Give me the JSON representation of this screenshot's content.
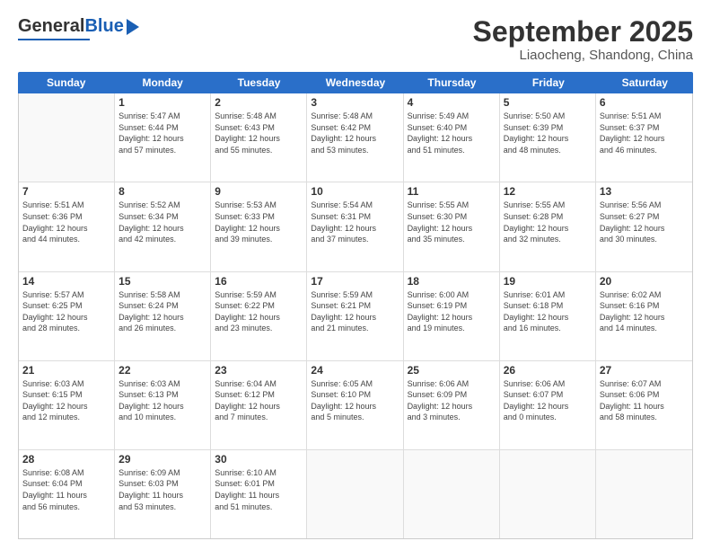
{
  "logo": {
    "general": "General",
    "blue": "Blue"
  },
  "title": {
    "main": "September 2025",
    "sub": "Liaocheng, Shandong, China"
  },
  "calendar": {
    "headers": [
      "Sunday",
      "Monday",
      "Tuesday",
      "Wednesday",
      "Thursday",
      "Friday",
      "Saturday"
    ],
    "rows": [
      [
        {
          "day": "",
          "info": ""
        },
        {
          "day": "1",
          "info": "Sunrise: 5:47 AM\nSunset: 6:44 PM\nDaylight: 12 hours\nand 57 minutes."
        },
        {
          "day": "2",
          "info": "Sunrise: 5:48 AM\nSunset: 6:43 PM\nDaylight: 12 hours\nand 55 minutes."
        },
        {
          "day": "3",
          "info": "Sunrise: 5:48 AM\nSunset: 6:42 PM\nDaylight: 12 hours\nand 53 minutes."
        },
        {
          "day": "4",
          "info": "Sunrise: 5:49 AM\nSunset: 6:40 PM\nDaylight: 12 hours\nand 51 minutes."
        },
        {
          "day": "5",
          "info": "Sunrise: 5:50 AM\nSunset: 6:39 PM\nDaylight: 12 hours\nand 48 minutes."
        },
        {
          "day": "6",
          "info": "Sunrise: 5:51 AM\nSunset: 6:37 PM\nDaylight: 12 hours\nand 46 minutes."
        }
      ],
      [
        {
          "day": "7",
          "info": "Sunrise: 5:51 AM\nSunset: 6:36 PM\nDaylight: 12 hours\nand 44 minutes."
        },
        {
          "day": "8",
          "info": "Sunrise: 5:52 AM\nSunset: 6:34 PM\nDaylight: 12 hours\nand 42 minutes."
        },
        {
          "day": "9",
          "info": "Sunrise: 5:53 AM\nSunset: 6:33 PM\nDaylight: 12 hours\nand 39 minutes."
        },
        {
          "day": "10",
          "info": "Sunrise: 5:54 AM\nSunset: 6:31 PM\nDaylight: 12 hours\nand 37 minutes."
        },
        {
          "day": "11",
          "info": "Sunrise: 5:55 AM\nSunset: 6:30 PM\nDaylight: 12 hours\nand 35 minutes."
        },
        {
          "day": "12",
          "info": "Sunrise: 5:55 AM\nSunset: 6:28 PM\nDaylight: 12 hours\nand 32 minutes."
        },
        {
          "day": "13",
          "info": "Sunrise: 5:56 AM\nSunset: 6:27 PM\nDaylight: 12 hours\nand 30 minutes."
        }
      ],
      [
        {
          "day": "14",
          "info": "Sunrise: 5:57 AM\nSunset: 6:25 PM\nDaylight: 12 hours\nand 28 minutes."
        },
        {
          "day": "15",
          "info": "Sunrise: 5:58 AM\nSunset: 6:24 PM\nDaylight: 12 hours\nand 26 minutes."
        },
        {
          "day": "16",
          "info": "Sunrise: 5:59 AM\nSunset: 6:22 PM\nDaylight: 12 hours\nand 23 minutes."
        },
        {
          "day": "17",
          "info": "Sunrise: 5:59 AM\nSunset: 6:21 PM\nDaylight: 12 hours\nand 21 minutes."
        },
        {
          "day": "18",
          "info": "Sunrise: 6:00 AM\nSunset: 6:19 PM\nDaylight: 12 hours\nand 19 minutes."
        },
        {
          "day": "19",
          "info": "Sunrise: 6:01 AM\nSunset: 6:18 PM\nDaylight: 12 hours\nand 16 minutes."
        },
        {
          "day": "20",
          "info": "Sunrise: 6:02 AM\nSunset: 6:16 PM\nDaylight: 12 hours\nand 14 minutes."
        }
      ],
      [
        {
          "day": "21",
          "info": "Sunrise: 6:03 AM\nSunset: 6:15 PM\nDaylight: 12 hours\nand 12 minutes."
        },
        {
          "day": "22",
          "info": "Sunrise: 6:03 AM\nSunset: 6:13 PM\nDaylight: 12 hours\nand 10 minutes."
        },
        {
          "day": "23",
          "info": "Sunrise: 6:04 AM\nSunset: 6:12 PM\nDaylight: 12 hours\nand 7 minutes."
        },
        {
          "day": "24",
          "info": "Sunrise: 6:05 AM\nSunset: 6:10 PM\nDaylight: 12 hours\nand 5 minutes."
        },
        {
          "day": "25",
          "info": "Sunrise: 6:06 AM\nSunset: 6:09 PM\nDaylight: 12 hours\nand 3 minutes."
        },
        {
          "day": "26",
          "info": "Sunrise: 6:06 AM\nSunset: 6:07 PM\nDaylight: 12 hours\nand 0 minutes."
        },
        {
          "day": "27",
          "info": "Sunrise: 6:07 AM\nSunset: 6:06 PM\nDaylight: 11 hours\nand 58 minutes."
        }
      ],
      [
        {
          "day": "28",
          "info": "Sunrise: 6:08 AM\nSunset: 6:04 PM\nDaylight: 11 hours\nand 56 minutes."
        },
        {
          "day": "29",
          "info": "Sunrise: 6:09 AM\nSunset: 6:03 PM\nDaylight: 11 hours\nand 53 minutes."
        },
        {
          "day": "30",
          "info": "Sunrise: 6:10 AM\nSunset: 6:01 PM\nDaylight: 11 hours\nand 51 minutes."
        },
        {
          "day": "",
          "info": ""
        },
        {
          "day": "",
          "info": ""
        },
        {
          "day": "",
          "info": ""
        },
        {
          "day": "",
          "info": ""
        }
      ]
    ]
  }
}
